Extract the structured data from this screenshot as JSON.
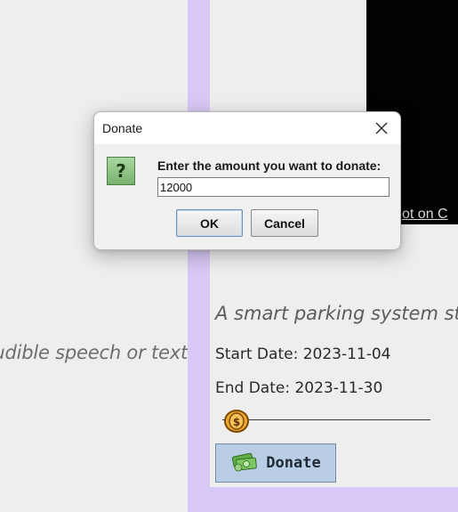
{
  "background_panel": {
    "caption": "udible speech or text."
  },
  "project_card": {
    "video_caption": "ot on C",
    "tagline": "A smart parking system str",
    "start_date": "Start Date: 2023-11-04",
    "end_date": "End Date: 2023-11-30",
    "progress_fraction": 0.07,
    "donate_label": "Donate",
    "donate_icon": "money-icon",
    "thumb_icon": "coin-icon"
  },
  "dialog": {
    "title": "Donate",
    "close_icon": "close-icon",
    "question_icon": "question-icon",
    "question_glyph": "?",
    "message": "Enter the amount you want to donate:",
    "amount_value": "12000",
    "ok_label": "OK",
    "cancel_label": "Cancel"
  },
  "colors": {
    "accent_purple": "#d8c8f6",
    "donate_button": "#b9cee4",
    "question_green": "#78b36c"
  }
}
